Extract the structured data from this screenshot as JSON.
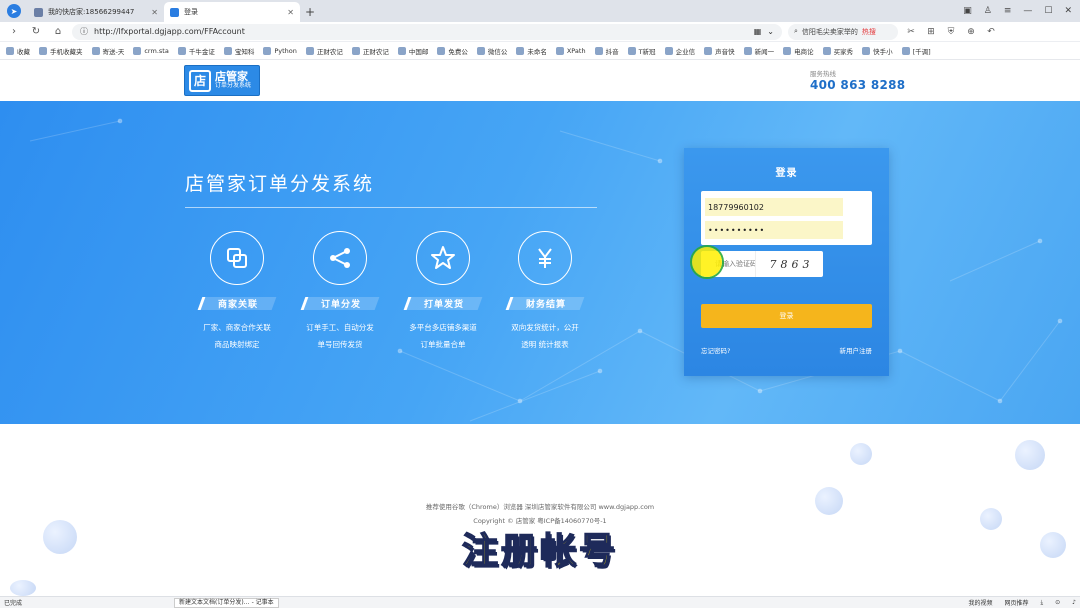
{
  "browser": {
    "tabs": [
      {
        "label": "我的快店家:18566299447",
        "active": false
      },
      {
        "label": "登录",
        "active": true
      }
    ],
    "new_tab": "+",
    "url": "http://lfxportal.dgjapp.com/FFAccount",
    "search_text": "信阳毛尖卖家举的",
    "search_hot": "热搜",
    "bookmarks": [
      "收藏",
      "手机收藏夹",
      "寄送-天",
      "crm.sta",
      "千牛金证",
      "宝知科",
      "Python",
      "正财农记",
      "正财农记",
      "中国邮",
      "免费公",
      "微信公",
      "未命名",
      "XPath",
      "抖音",
      "T新冠",
      "企业信",
      "声音快",
      "新闻一",
      "电商论",
      "买家秀",
      "快手小",
      "[千调]"
    ]
  },
  "header": {
    "logo_mark": "店",
    "logo_main": "店管家",
    "logo_sub": "订单分发系统",
    "hotline_label": "服务热线",
    "hotline_number": "400 863 8288"
  },
  "hero": {
    "title": "店管家订单分发系统",
    "features": [
      {
        "icon": "link-squares-icon",
        "label": "商家关联",
        "desc1": "厂家、商家合作关联",
        "desc2": "商品映射绑定"
      },
      {
        "icon": "share-icon",
        "label": "订单分发",
        "desc1": "订单手工、自动分发",
        "desc2": "单号回传发货"
      },
      {
        "icon": "star-icon",
        "label": "打单发货",
        "desc1": "多平台多店铺多渠道",
        "desc2": "订单批量合单"
      },
      {
        "icon": "yen-icon",
        "label": "财务结算",
        "desc1": "双向发货统计，公开",
        "desc2": "透明 统计报表"
      }
    ]
  },
  "login": {
    "title": "登录",
    "username": "18779960102",
    "password": "••••••••••",
    "captcha_placeholder": "请输入验证码",
    "captcha_chars": [
      "7",
      "8",
      "6",
      "3"
    ],
    "submit_label": "登录",
    "forgot_label": "忘记密码?",
    "register_label": "新用户注册"
  },
  "footer": {
    "line1": "推荐使用谷歌（Chrome）浏览器 深圳店管家软件有限公司 www.dgjapp.com",
    "line2": "Copyright © 店管家 粤ICP备14060770号-1"
  },
  "subtitle": "注册帐号",
  "statusbar": {
    "left": "已完成",
    "file": "新建文本文档(订单分发)… - 记事本",
    "items": [
      "我的视频",
      "网页推荐"
    ]
  },
  "colors": {
    "hero_blue": "#3d9cf2",
    "accent_yellow": "#f5b51c",
    "brand_blue": "#1f6fc8"
  }
}
